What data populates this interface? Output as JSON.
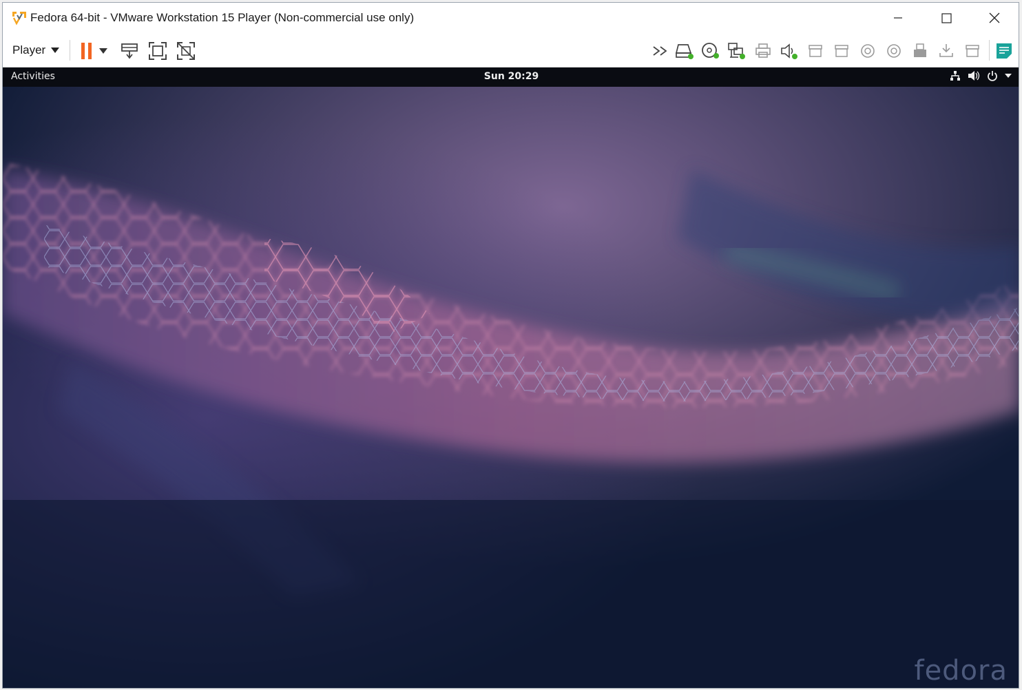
{
  "window": {
    "title": "Fedora 64-bit - VMware Workstation 15 Player (Non-commercial use only)",
    "app_icon": "vmware-player-icon",
    "controls": [
      "minimize-icon",
      "maximize-icon",
      "close-icon"
    ]
  },
  "toolbar": {
    "player_menu_label": "Player",
    "actions": [
      "pause-icon",
      "send-ctrl-alt-del-icon",
      "full-screen-icon",
      "unity-icon"
    ],
    "devices": [
      "more-devices-icon",
      "hard-disk-icon",
      "cd-dvd-icon",
      "network-adapter-icon",
      "printer-icon",
      "sound-card-icon",
      "usb-device-icon",
      "usb-device-icon",
      "disc-icon",
      "disc-icon",
      "usb-drive-icon",
      "usb-download-icon",
      "usb-device-icon",
      "message-log-icon"
    ]
  },
  "gnome_panel": {
    "activities": "Activities",
    "clock": "Sun 20:29",
    "status_icons": [
      "network-icon",
      "volume-icon",
      "power-icon",
      "menu-arrow-icon"
    ]
  },
  "desktop": {
    "brand_watermark": "fedora"
  },
  "colors": {
    "pause_accent": "#f26522",
    "status_green": "#43b02a",
    "log_teal": "#1aa39a",
    "desktop_base": "#0e1a33"
  }
}
